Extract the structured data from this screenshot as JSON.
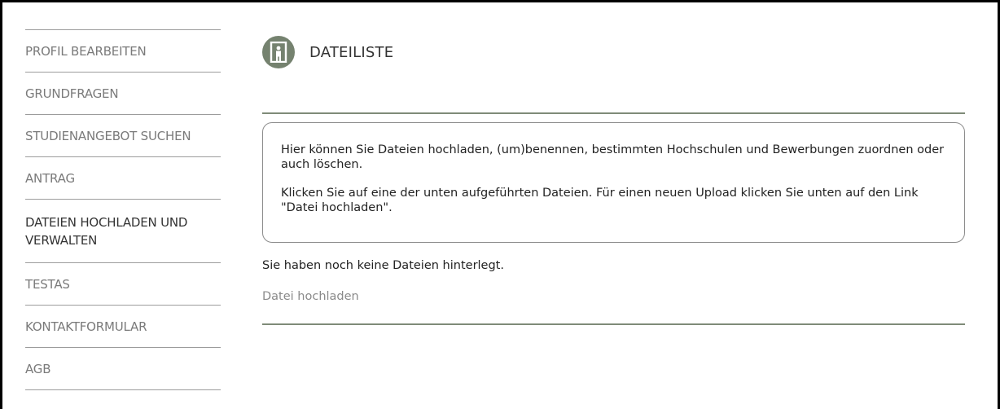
{
  "sidebar": {
    "items": [
      {
        "label": "PROFIL BEARBEITEN"
      },
      {
        "label": "GRUNDFRAGEN"
      },
      {
        "label": "STUDIENANGEBOT SUCHEN"
      },
      {
        "label": "ANTRAG"
      },
      {
        "label": "DATEIEN HOCHLADEN UND VERWALTEN",
        "active": true
      },
      {
        "label": "TESTAS"
      },
      {
        "label": "KONTAKTFORMULAR"
      },
      {
        "label": "AGB"
      }
    ]
  },
  "main": {
    "title": "DATEILISTE",
    "info": {
      "paragraph1": "Hier können Sie Dateien hochladen, (um)benennen, bestimmten Hochschulen und Bewerbungen zuordnen oder auch löschen.",
      "paragraph2": "Klicken Sie auf eine der unten aufgeführten Dateien. Für einen neuen Upload klicken Sie unten auf den Link \"Datei hochladen\"."
    },
    "notice": "Sie haben noch keine Dateien hinterlegt.",
    "upload_link": "Datei hochladen"
  },
  "colors": {
    "accent": "#75826f",
    "rule": "#7f8b78",
    "nav_text": "#7a7a7a",
    "nav_active_text": "#333333"
  },
  "icons": {
    "logo": "door-person-icon"
  }
}
